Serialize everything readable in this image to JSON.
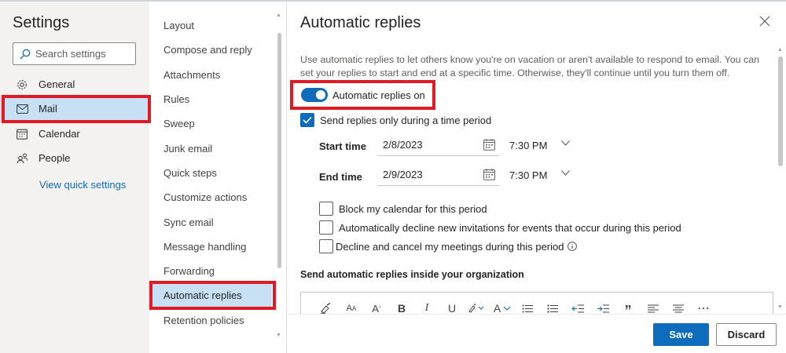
{
  "settings_pane": {
    "title": "Settings",
    "search_placeholder": "Search settings",
    "nav": [
      {
        "label": "General",
        "icon": "gear-icon"
      },
      {
        "label": "Mail",
        "icon": "mail-icon",
        "selected": true
      },
      {
        "label": "Calendar",
        "icon": "calendar-icon"
      },
      {
        "label": "People",
        "icon": "people-icon"
      }
    ],
    "quick_settings_link": "View quick settings"
  },
  "mail_categories": [
    {
      "label": "Layout"
    },
    {
      "label": "Compose and reply"
    },
    {
      "label": "Attachments"
    },
    {
      "label": "Rules"
    },
    {
      "label": "Sweep"
    },
    {
      "label": "Junk email"
    },
    {
      "label": "Quick steps"
    },
    {
      "label": "Customize actions"
    },
    {
      "label": "Sync email"
    },
    {
      "label": "Message handling"
    },
    {
      "label": "Forwarding"
    },
    {
      "label": "Automatic replies",
      "selected": true
    },
    {
      "label": "Retention policies"
    }
  ],
  "detail": {
    "title": "Automatic replies",
    "description": "Use automatic replies to let others know you're on vacation or aren't available to respond to email. You can set your replies to start and end at a specific time. Otherwise, they'll continue until you turn them off.",
    "toggle_label": "Automatic replies on",
    "toggle_on": true,
    "time_period_label": "Send replies only during a time period",
    "time_period_checked": true,
    "start_label": "Start time",
    "start_date": "2/8/2023",
    "start_time": "7:30 PM",
    "end_label": "End time",
    "end_date": "2/9/2023",
    "end_time": "7:30 PM",
    "options": [
      {
        "label": "Block my calendar for this period",
        "checked": false
      },
      {
        "label": "Automatically decline new invitations for events that occur during this period",
        "checked": false
      },
      {
        "label": "Decline and cancel my meetings during this period",
        "checked": false
      }
    ],
    "inside_org_heading": "Send automatic replies inside your organization",
    "toolbar": {
      "bold": "B",
      "italic": "I",
      "underline": "U",
      "font_color": "A",
      "quote": "”",
      "more": "⋯"
    }
  },
  "footer": {
    "save_label": "Save",
    "discard_label": "Discard"
  },
  "colors": {
    "accent": "#0f6cbd",
    "selected_bg": "#c7e0f4",
    "annotation_red": "#e01b24"
  }
}
